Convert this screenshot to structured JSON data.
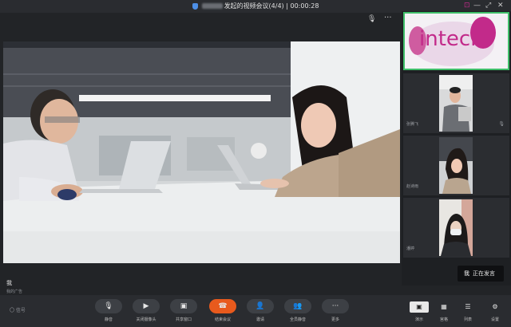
{
  "titlebar": {
    "title_suffix": "发起的视频会议(4/4)",
    "timer": "00:00:28",
    "separator": "|",
    "pin_glyph": "⊡",
    "min_glyph": "—",
    "restore_glyph": "⤢",
    "close_glyph": "✕"
  },
  "main": {
    "mic_glyph": "🎙",
    "more_glyph": "···",
    "self_name": "我",
    "self_sub": "我的广告"
  },
  "share": {
    "logo_text": "intech",
    "colors": {
      "logo": "#c22a8a",
      "border": "#3fbf6a"
    }
  },
  "participants": [
    {
      "name": "张腾飞",
      "mic_glyph": "🎙"
    },
    {
      "name": "赵诗雨",
      "mic_glyph": ""
    },
    {
      "name": "潘婷",
      "mic_glyph": ""
    }
  ],
  "speaking": {
    "name": "我",
    "text": "正在发言"
  },
  "signal": "〇 信号",
  "toolbar": [
    {
      "label": "静音",
      "glyph": "🎙"
    },
    {
      "label": "关闭摄像头",
      "glyph": "▶"
    },
    {
      "label": "共享窗口",
      "glyph": "▣"
    },
    {
      "label": "结束会议",
      "glyph": "☎"
    },
    {
      "label": "邀请",
      "glyph": "👤"
    },
    {
      "label": "全员静音",
      "glyph": "👥"
    },
    {
      "label": "更多",
      "glyph": "···"
    }
  ],
  "layout": [
    {
      "label": "演示",
      "glyph": "▣"
    },
    {
      "label": "宫格",
      "glyph": "▦"
    },
    {
      "label": "列表",
      "glyph": "☰"
    },
    {
      "label": "设置",
      "glyph": "⚙"
    }
  ]
}
